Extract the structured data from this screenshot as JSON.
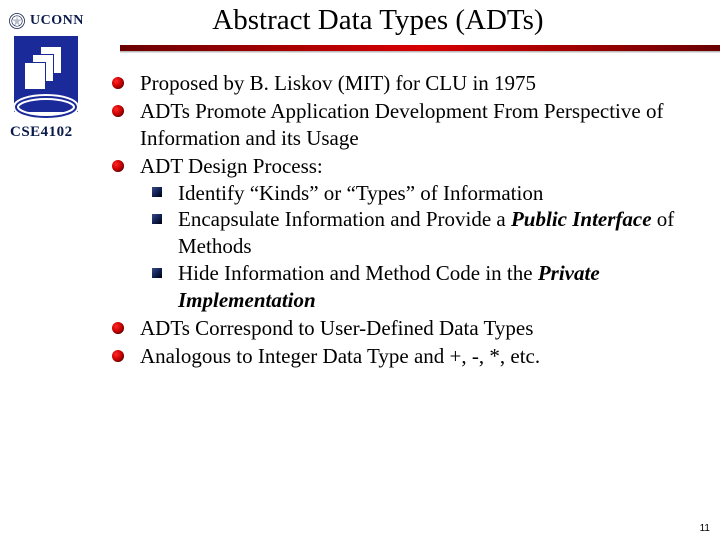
{
  "brand": {
    "name": "UCONN",
    "course": "CSE4102"
  },
  "title": "Abstract Data Types (ADTs)",
  "bullets": [
    {
      "kind": "m",
      "text": "Proposed by B. Liskov (MIT) for CLU in 1975"
    },
    {
      "kind": "m",
      "text": "ADTs Promote Application Development From Perspective of Information and its Usage"
    },
    {
      "kind": "m",
      "text": "ADT Design Process:"
    },
    {
      "kind": "q",
      "text": "Identify “Kinds” or “Types” of Information"
    },
    {
      "kind": "q",
      "pre": "Encapsulate Information and Provide a ",
      "em": "Public Interface",
      "post": " of Methods"
    },
    {
      "kind": "q",
      "pre": "Hide Information and Method Code in the ",
      "em": "Private Implementation",
      "post": ""
    },
    {
      "kind": "m",
      "text": "ADTs Correspond to User-Defined Data Types"
    },
    {
      "kind": "m",
      "text": "Analogous to Integer Data Type and +, -, *, etc."
    }
  ],
  "page_number": "11"
}
